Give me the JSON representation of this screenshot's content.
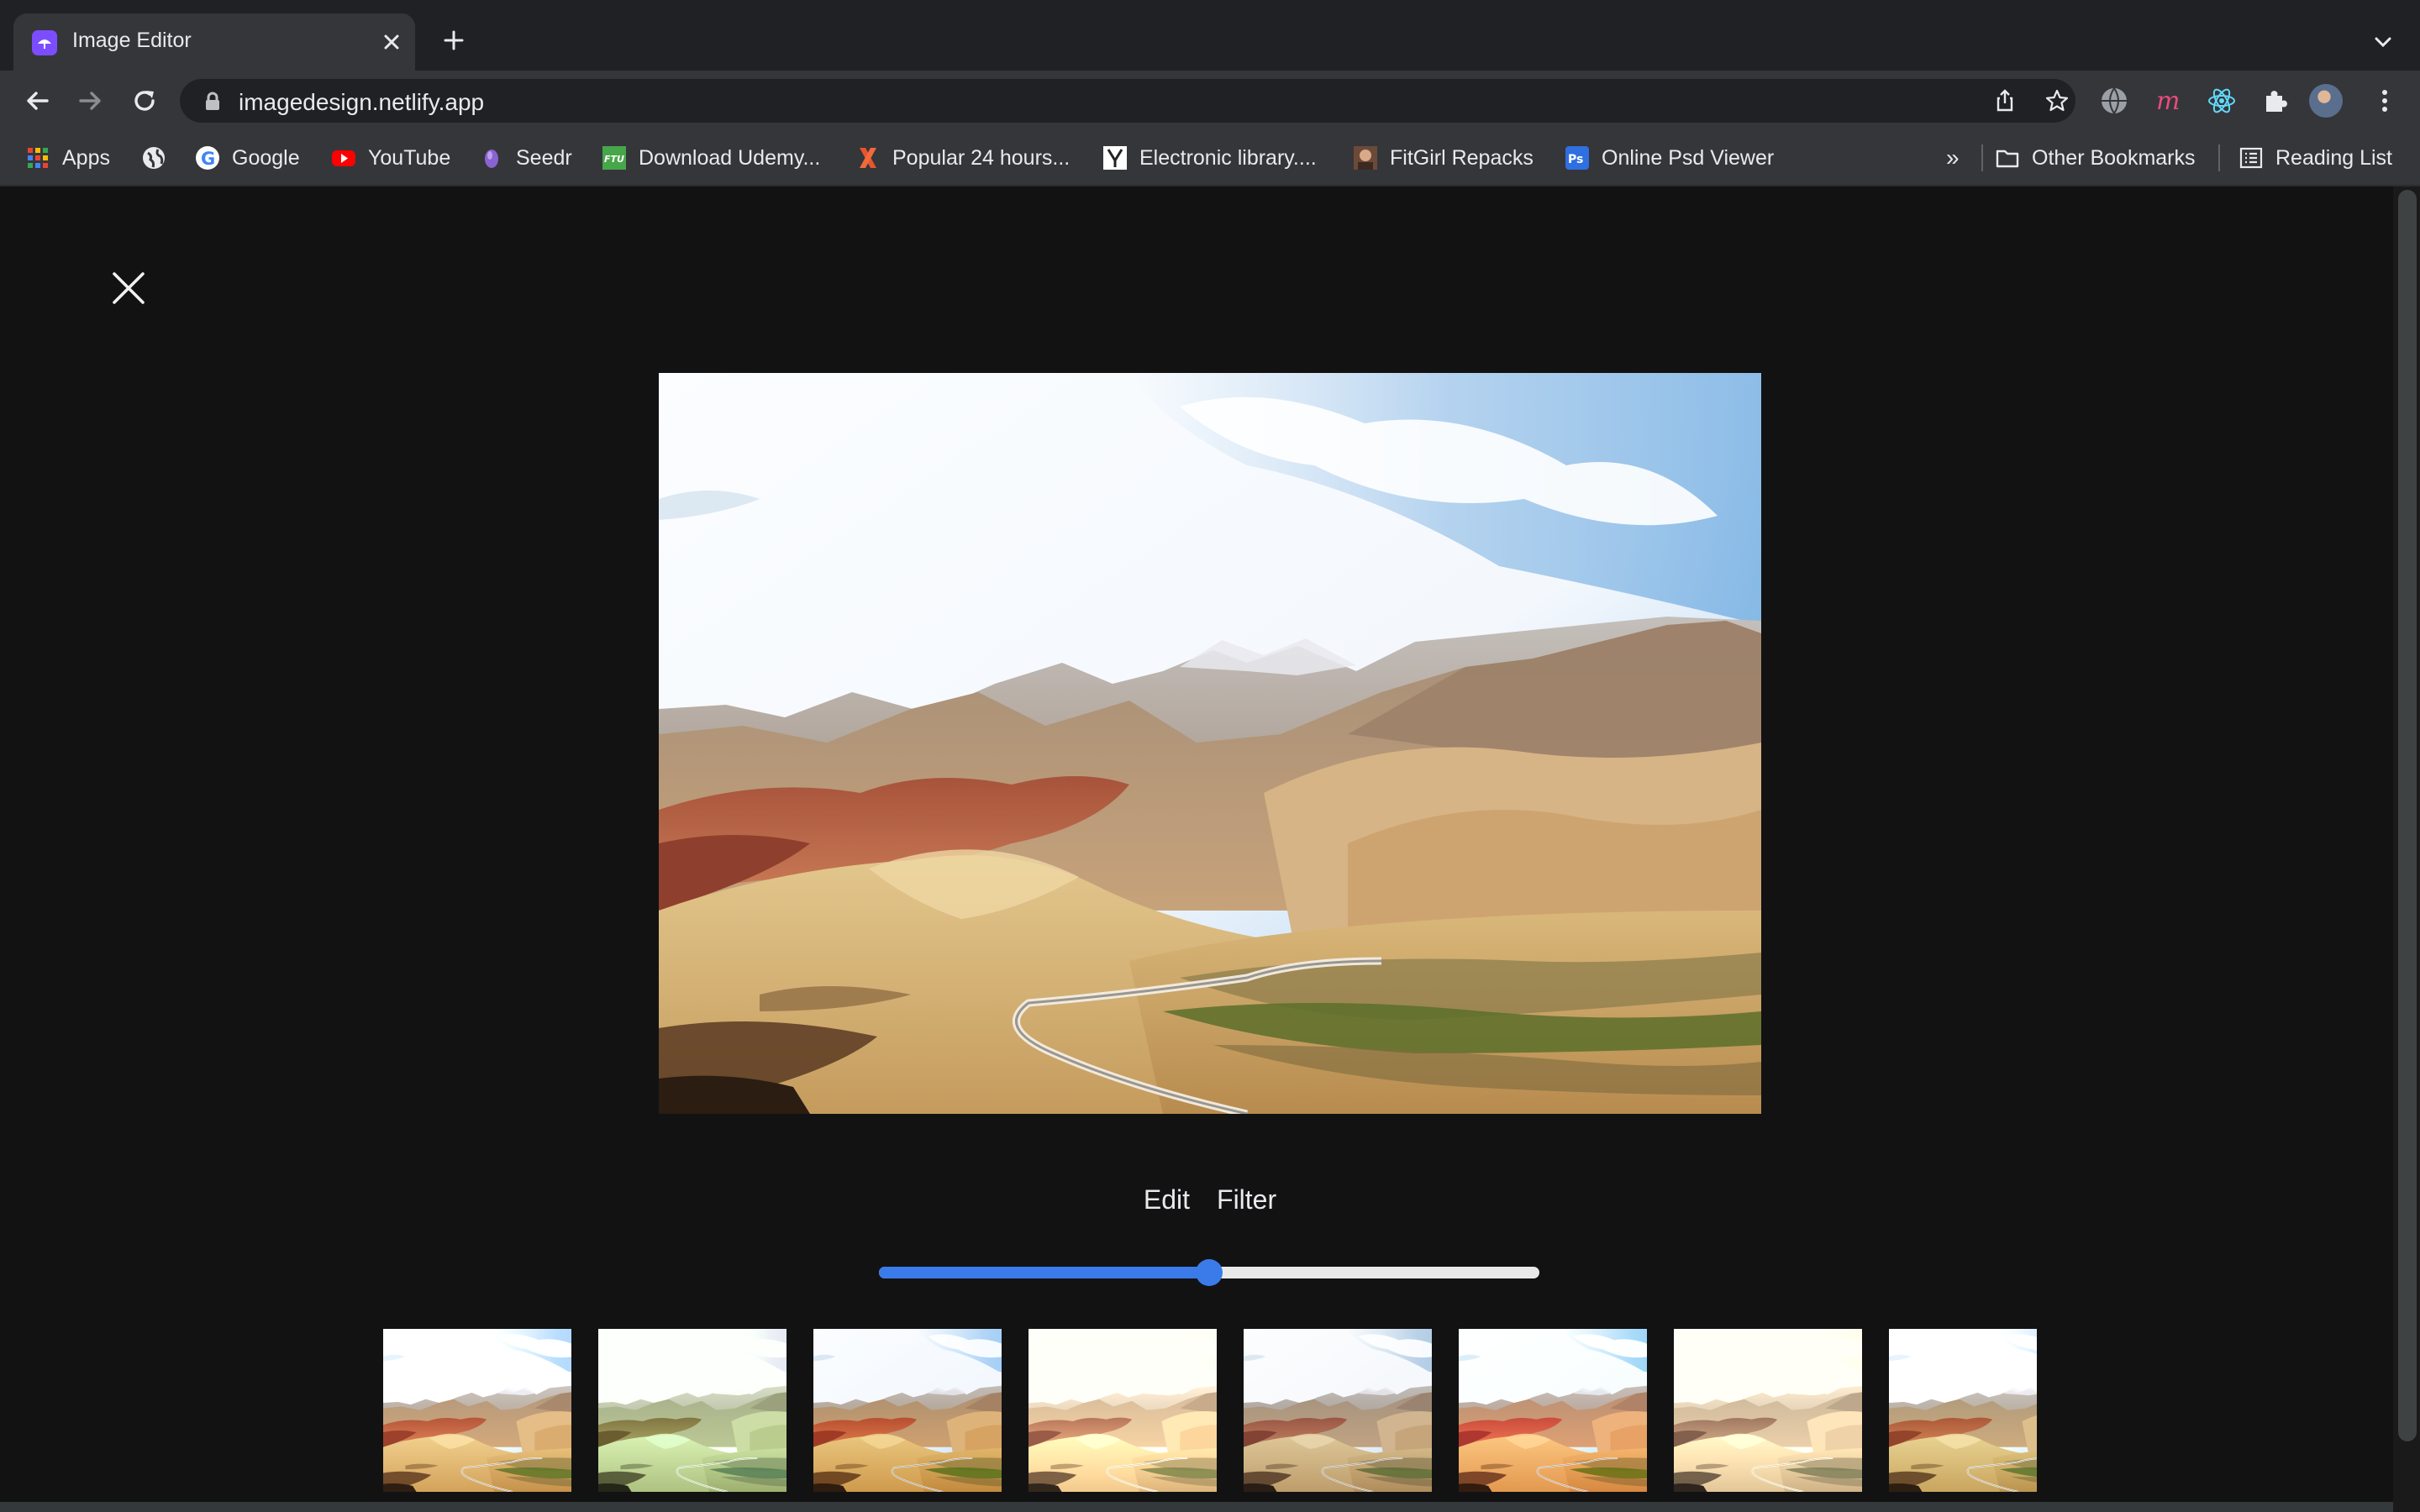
{
  "browser": {
    "tab": {
      "title": "Image Editor",
      "favicon": "umbrella-icon"
    },
    "new_tab_icon": "plus-icon",
    "tab_search_icon": "chevron-down-icon",
    "url": "imagedesign.netlify.app",
    "extensions": [
      "globe-icon",
      "m-logo-icon",
      "react-icon",
      "puzzle-icon"
    ]
  },
  "bookmarks": {
    "items": [
      {
        "label": "Apps",
        "icon": "apps-grid-icon"
      },
      {
        "label": "",
        "icon": "globe-icon"
      },
      {
        "label": "Google",
        "icon": "google-icon"
      },
      {
        "label": "YouTube",
        "icon": "youtube-icon"
      },
      {
        "label": "Seedr",
        "icon": "seedr-icon"
      },
      {
        "label": "Download Udemy...",
        "icon": "ftu-icon"
      },
      {
        "label": "Popular 24 hours...",
        "icon": "x-logo-icon"
      },
      {
        "label": "Electronic library....",
        "icon": "y-logo-icon"
      },
      {
        "label": "FitGirl Repacks",
        "icon": "fitgirl-icon"
      },
      {
        "label": "Online Psd Viewer",
        "icon": "ps-icon"
      }
    ],
    "overflow": "»",
    "other": "Other Bookmarks",
    "reading_list": "Reading List"
  },
  "editor": {
    "tabs": {
      "edit": "Edit",
      "filter": "Filter"
    },
    "slider_value": 0.5,
    "accent_color": "#3b7be9",
    "thumbnail_count": 8
  }
}
